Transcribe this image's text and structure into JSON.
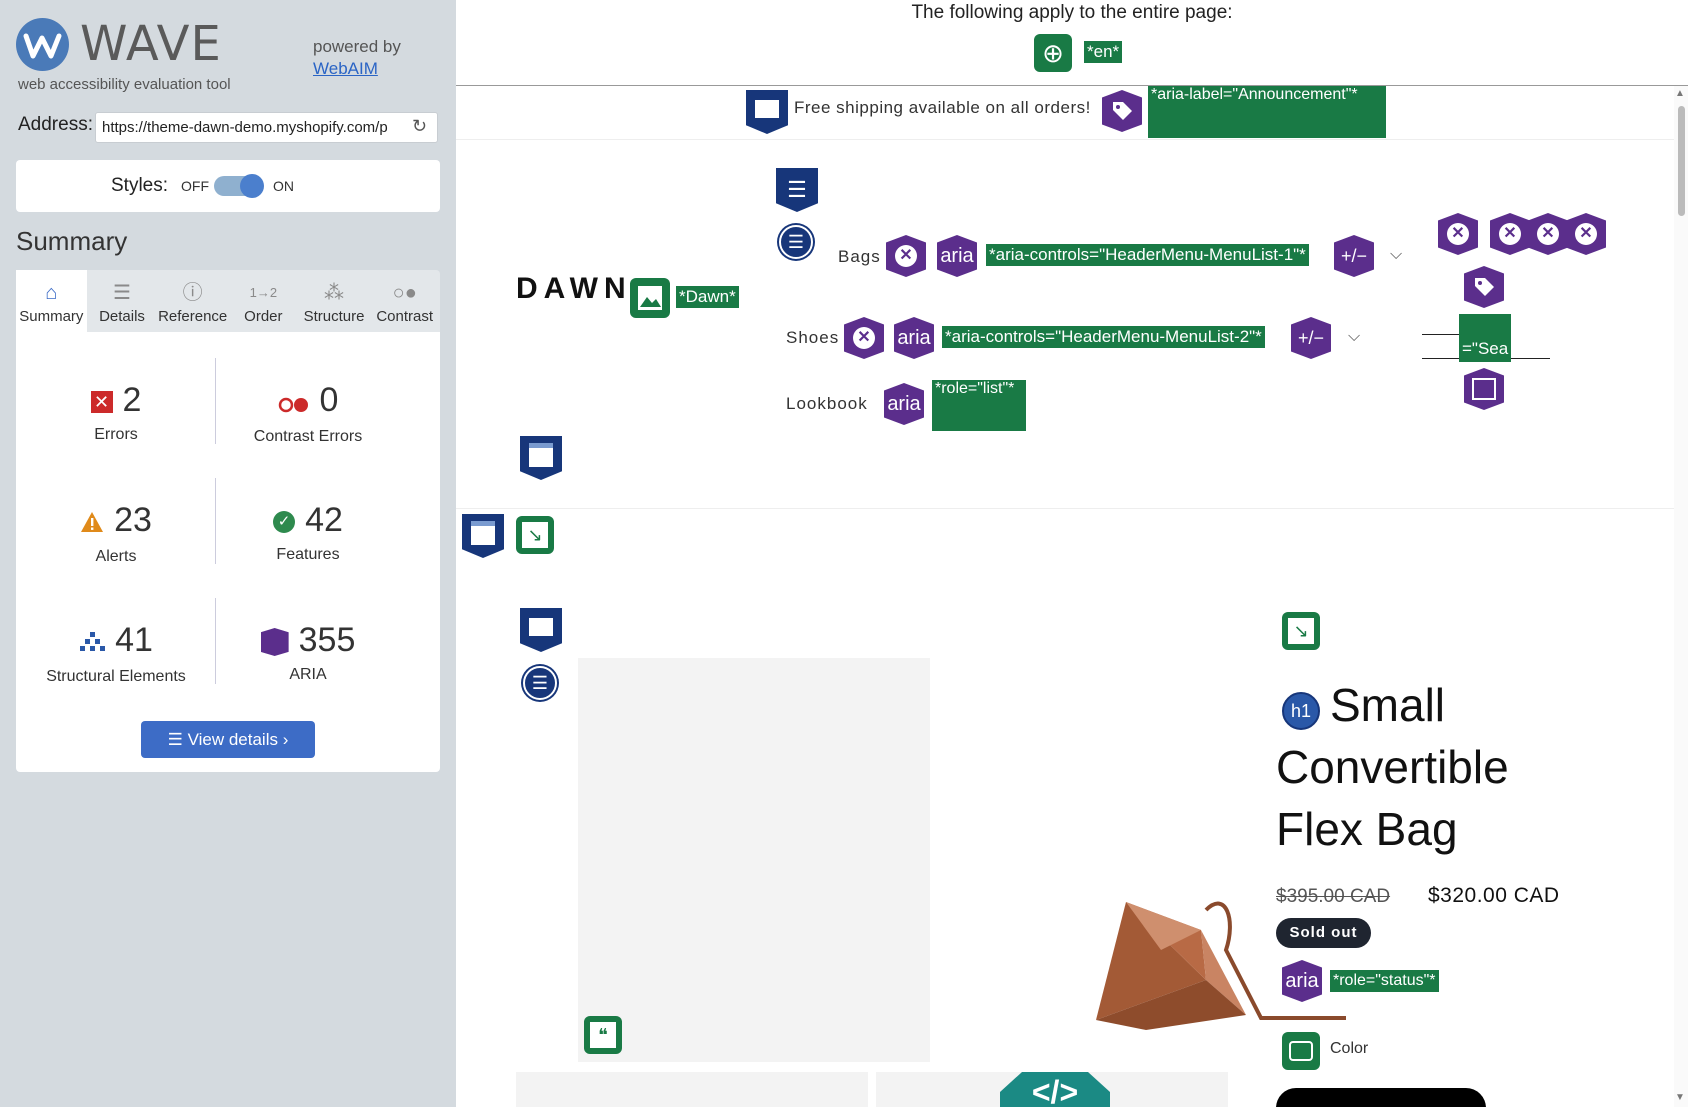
{
  "sidebar": {
    "logo_text": "WAVE",
    "logo_sub": "web accessibility evaluation tool",
    "powered_by": "powered by",
    "webaim_link": "WebAIM",
    "address_label": "Address:",
    "address_value": "https://theme-dawn-demo.myshopify.com/p",
    "styles_label": "Styles:",
    "styles_off": "OFF",
    "styles_on": "ON",
    "summary_title": "Summary",
    "tabs": [
      {
        "label": "Summary",
        "icon": "home-icon"
      },
      {
        "label": "Details",
        "icon": "list-icon"
      },
      {
        "label": "Reference",
        "icon": "info-icon"
      },
      {
        "label": "Order",
        "icon": "order-icon"
      },
      {
        "label": "Structure",
        "icon": "structure-icon"
      },
      {
        "label": "Contrast",
        "icon": "contrast-icon"
      }
    ],
    "stats": {
      "errors": {
        "value": "2",
        "label": "Errors"
      },
      "contrast": {
        "value": "0",
        "label": "Contrast Errors"
      },
      "alerts": {
        "value": "23",
        "label": "Alerts"
      },
      "features": {
        "value": "42",
        "label": "Features"
      },
      "structural": {
        "value": "41",
        "label": "Structural Elements"
      },
      "aria": {
        "value": "355",
        "label": "ARIA"
      }
    },
    "view_details": "View details ›"
  },
  "page": {
    "top_notice": "The following apply to the entire page:",
    "lang_chip": "*en*",
    "announcement": "Free shipping available on all orders!",
    "announcement_chip": "*aria-label=\"Announcement\"*",
    "store_logo": "DAWN",
    "logo_chip": "*Dawn*",
    "nav": [
      {
        "label": "Bags",
        "chip": "*aria-controls=\"HeaderMenu-MenuList-1\"*"
      },
      {
        "label": "Shoes",
        "chip": "*aria-controls=\"HeaderMenu-MenuList-2\"*"
      },
      {
        "label": "Lookbook",
        "chip": "*role=\"list\"*"
      }
    ],
    "search_chip": "=\"Sea",
    "aria_label": "aria",
    "plus_minus": "+/−",
    "h1_badge": "h1",
    "product_title_lines": [
      "Small",
      "Convertible",
      "Flex Bag"
    ],
    "price_old": "$395.00 CAD",
    "price_new": "$320.00 CAD",
    "sold_out": "Sold out",
    "status_chip": "*role=\"status\"*",
    "color_label": "Color",
    "code_badge": "</>"
  },
  "colors": {
    "wave_blue": "#3d6cc6",
    "wave_green": "#197a45",
    "wave_purple": "#5b2e8c",
    "wave_navy": "#17367a",
    "error_red": "#cc2a2a"
  }
}
